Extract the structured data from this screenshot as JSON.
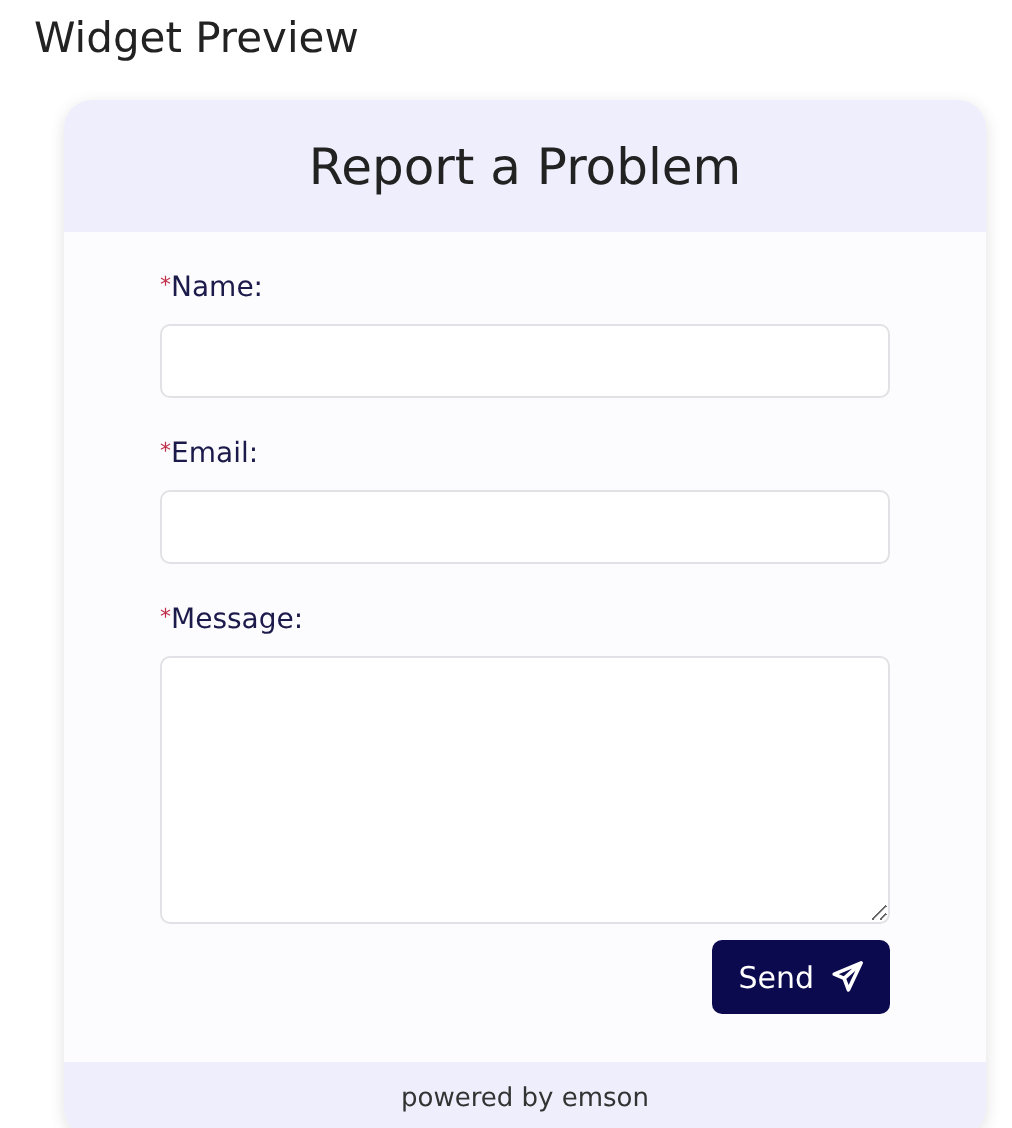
{
  "page_title": "Widget Preview",
  "widget": {
    "title": "Report a Problem",
    "fields": [
      {
        "kind": "input",
        "required_mark": "*",
        "label": "Name:"
      },
      {
        "kind": "input",
        "required_mark": "*",
        "label": "Email:"
      },
      {
        "kind": "textarea",
        "required_mark": "*",
        "label": "Message:"
      }
    ],
    "submit_button": {
      "label": "Send"
    },
    "footer": "powered by emson"
  }
}
